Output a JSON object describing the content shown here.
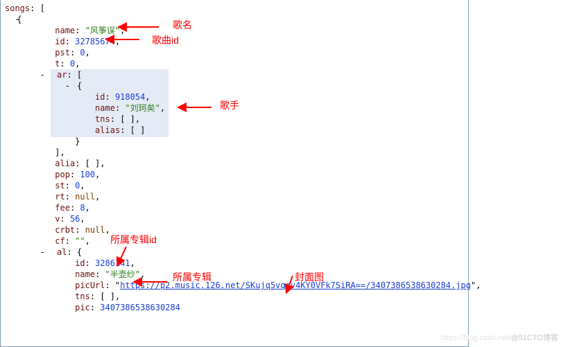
{
  "code": {
    "songs_key": "songs",
    "name_key": "name",
    "name_val": "\"风筝误\"",
    "id_key": "id",
    "id_val": "32785674",
    "pst_key": "pst",
    "pst_val": "0",
    "t_key": "t",
    "t_val": "0",
    "ar_key": "ar",
    "ar_id_key": "id",
    "ar_id_val": "918054",
    "ar_name_key": "name",
    "ar_name_val": "\"刘珂矣\"",
    "ar_tns_key": "tns",
    "ar_tns_val": "[ ]",
    "ar_alias_key": "alias",
    "ar_alias_val": "[ ]",
    "alia_key": "alia",
    "alia_val": "[ ]",
    "pop_key": "pop",
    "pop_val": "100",
    "st_key": "st",
    "st_val": "0",
    "rt_key": "rt",
    "rt_val": "null",
    "fee_key": "fee",
    "fee_val": "8",
    "v_key": "v",
    "v_val": "56",
    "crbt_key": "crbt",
    "crbt_val": "null",
    "cf_key": "cf",
    "cf_val": "\"\"",
    "al_key": "al",
    "al_id_key": "id",
    "al_id_val": "3286141",
    "al_name_key": "name",
    "al_name_val": "\"半壶纱\"",
    "al_picurl_key": "picUrl",
    "al_picurl_val": "https://p2.music.126.net/SKujq5vqqv4KY0VFk7SiRA==/3407386538630284.jpg",
    "al_tns_key": "tns",
    "al_tns_val": "[ ]",
    "al_pic_key": "pic",
    "al_pic_val": "3407386538630284"
  },
  "ann": {
    "song_name": "歌名",
    "song_id": "歌曲id",
    "artist": "歌手",
    "album_id": "所属专辑id",
    "album": "所属专辑",
    "cover": "封面图"
  },
  "watermark": {
    "left": "https://blog.csdn.net/",
    "right": "@51CTO博客"
  }
}
